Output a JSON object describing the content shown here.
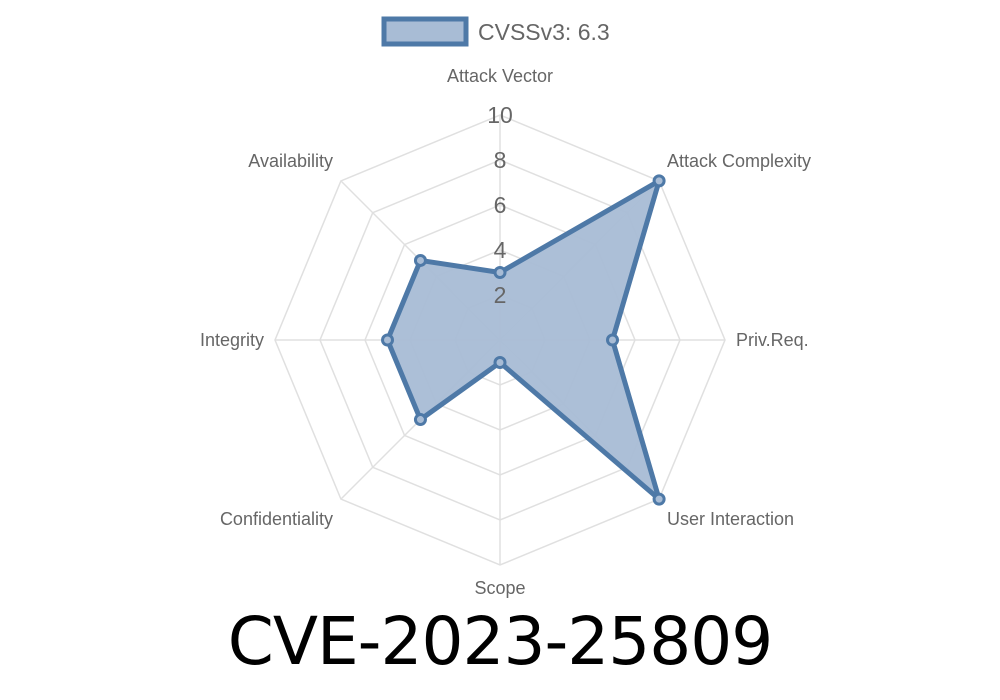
{
  "title": "CVE-2023-25809",
  "chart_data": {
    "type": "radar",
    "title": "CVE-2023-25809",
    "legend": {
      "label": "CVSSv3: 6.3",
      "position": "top"
    },
    "axes": [
      "Attack Vector",
      "Attack Complexity",
      "Priv.Req.",
      "User Interaction",
      "Scope",
      "Confidentiality",
      "Integrity",
      "Availability"
    ],
    "ticks": [
      "2",
      "4",
      "6",
      "8",
      "10"
    ],
    "range": [
      0,
      10
    ],
    "grid": true,
    "series": [
      {
        "name": "CVSSv3: 6.3",
        "values": [
          3,
          10,
          5,
          10,
          1,
          5,
          5,
          5
        ]
      }
    ],
    "colors": {
      "line": "#4e79a7",
      "fill": "#a8bcd5",
      "grid": "#e0e0e0",
      "text": "#666666"
    }
  }
}
